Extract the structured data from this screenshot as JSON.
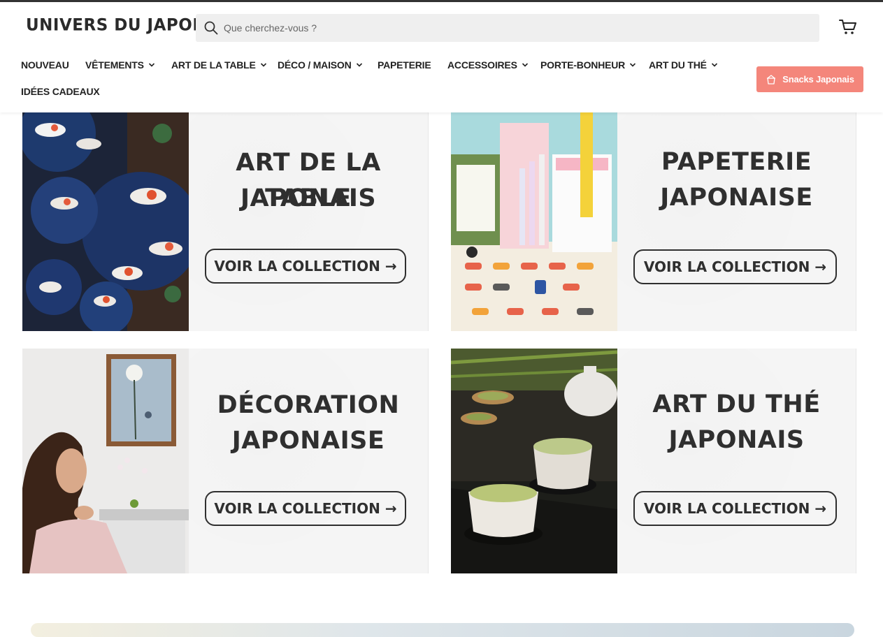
{
  "header": {
    "logo": "UNIVERS DU JAPON",
    "search_placeholder": "Que cherchez-vous ?",
    "nav": [
      {
        "label": "NOUVEAU",
        "has_dropdown": false
      },
      {
        "label": "VÊTEMENTS",
        "has_dropdown": true
      },
      {
        "label": "ART DE LA TABLE",
        "has_dropdown": true
      },
      {
        "label": "DÉCO / MAISON",
        "has_dropdown": true
      },
      {
        "label": "PAPETERIE",
        "has_dropdown": false
      },
      {
        "label": "ACCESSOIRES",
        "has_dropdown": true
      },
      {
        "label": "PORTE-BONHEUR",
        "has_dropdown": true
      },
      {
        "label": "ART DU THÉ",
        "has_dropdown": true
      },
      {
        "label": "IDÉES CADEAUX",
        "has_dropdown": false
      }
    ],
    "snacks_button": "Snacks Japonais"
  },
  "collections": [
    {
      "title_line1": "ART DE LA TABLE",
      "title_line2": "JAPONAIS",
      "cta": "VOIR LA COLLECTION →"
    },
    {
      "title_line1": "PAPETERIE",
      "title_line2": "JAPONAISE",
      "cta": "VOIR LA COLLECTION →"
    },
    {
      "title_line1": "DÉCORATION",
      "title_line2": "JAPONAISE",
      "cta": "VOIR LA COLLECTION →"
    },
    {
      "title_line1": "ART DU THÉ",
      "title_line2": "JAPONAIS",
      "cta": "VOIR LA COLLECTION →"
    }
  ],
  "colors": {
    "accent": "#f4867b",
    "text_dark": "#2f2f2f",
    "search_bg": "#efefef"
  }
}
